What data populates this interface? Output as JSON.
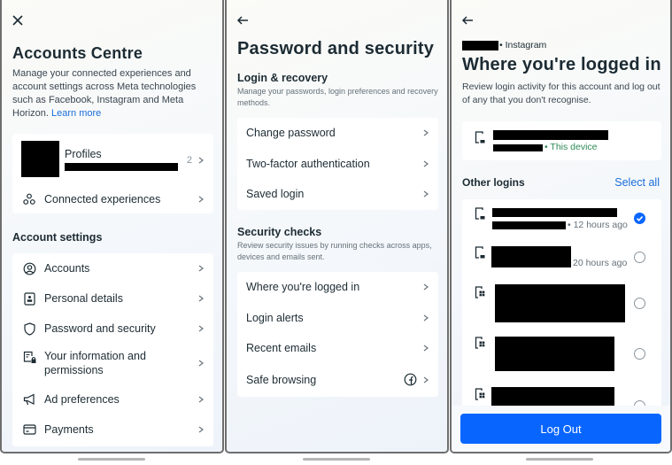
{
  "accounts_centre": {
    "close_icon": "close-icon",
    "title": "Accounts Centre",
    "description": "Manage your connected experiences and account settings across Meta technologies such as Facebook, Instagram and Meta Horizon.",
    "learn_more": "Learn more",
    "profiles": {
      "label": "Profiles",
      "count": "2"
    },
    "connected_experiences": "Connected experiences",
    "account_settings_title": "Account settings",
    "settings": [
      {
        "label": "Accounts",
        "icon": "user-circle-icon"
      },
      {
        "label": "Personal details",
        "icon": "id-card-icon"
      },
      {
        "label": "Password and security",
        "icon": "shield-icon"
      },
      {
        "label": "Your information and permissions",
        "icon": "document-lock-icon"
      },
      {
        "label": "Ad preferences",
        "icon": "megaphone-icon"
      },
      {
        "label": "Payments",
        "icon": "credit-card-icon"
      }
    ]
  },
  "password_security": {
    "back_icon": "back-arrow-icon",
    "title": "Password and security",
    "login_recovery": {
      "title": "Login & recovery",
      "subtitle": "Manage your passwords, login preferences and recovery methods.",
      "items": [
        "Change password",
        "Two-factor authentication",
        "Saved login"
      ]
    },
    "security_checks": {
      "title": "Security checks",
      "subtitle": "Review security issues by running checks across apps, devices and emails sent.",
      "items": [
        "Where you're logged in",
        "Login alerts",
        "Recent emails",
        "Safe browsing"
      ]
    }
  },
  "where_logged_in": {
    "back_icon": "back-arrow-icon",
    "account_suffix": "• Instagram",
    "title": "Where you're logged in",
    "description": "Review login activity for this account and log out of any that you don't recognise.",
    "this_device": "• This device",
    "other_logins_title": "Other logins",
    "select_all": "Select all",
    "logins": [
      {
        "time": "• 12 hours ago",
        "device": "phone",
        "selected": true
      },
      {
        "time": "20 hours ago",
        "device": "phone",
        "selected": false
      },
      {
        "time": "",
        "device": "windows",
        "selected": false
      },
      {
        "time": "",
        "device": "windows",
        "selected": false
      },
      {
        "time": "",
        "device": "windows",
        "selected": false
      }
    ],
    "logout_button": "Log Out"
  },
  "colors": {
    "accent_blue": "#0866ff",
    "link_blue": "#1a6ed8",
    "this_device_green": "#2e8b57"
  }
}
